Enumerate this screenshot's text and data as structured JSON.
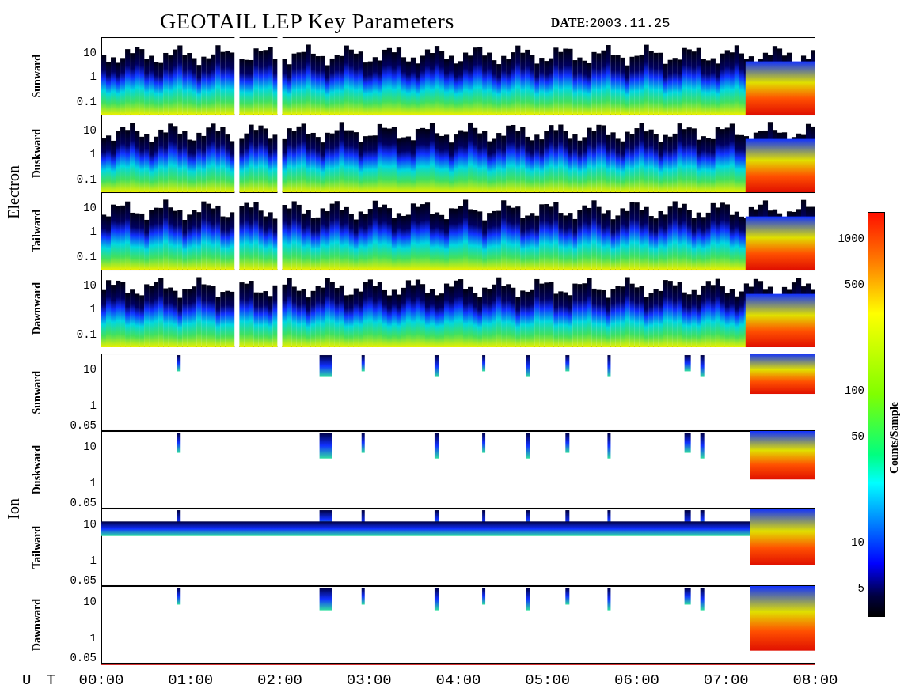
{
  "title": "GEOTAIL LEP Key Parameters",
  "date_label": "DATE:",
  "date": "2003.11.25",
  "groups": [
    {
      "name": "Electron",
      "kind": "electron",
      "panels": [
        {
          "name": "Sunward",
          "yticks": [
            "10",
            "1",
            "0.1"
          ]
        },
        {
          "name": "Duskward",
          "yticks": [
            "10",
            "1",
            "0.1"
          ]
        },
        {
          "name": "Tailward",
          "yticks": [
            "10",
            "1",
            "0.1"
          ]
        },
        {
          "name": "Dawnward",
          "yticks": [
            "10",
            "1",
            "0.1"
          ]
        }
      ]
    },
    {
      "name": "Ion",
      "kind": "ion",
      "panels": [
        {
          "name": "Sunward",
          "yticks": [
            "10",
            "1",
            "0.05"
          ]
        },
        {
          "name": "Duskward",
          "yticks": [
            "10",
            "1",
            "0.05"
          ]
        },
        {
          "name": "Tailward",
          "yticks": [
            "10",
            "1",
            "0.05"
          ]
        },
        {
          "name": "Dawnward",
          "yticks": [
            "10",
            "1",
            "0.05"
          ]
        }
      ]
    }
  ],
  "colorbar": {
    "label": "Counts/Sample",
    "ticks": [
      "1000",
      "500",
      "100",
      "50",
      "10",
      "5"
    ]
  },
  "x_axis": {
    "label": "U T",
    "ticks": [
      "00:00",
      "01:00",
      "02:00",
      "03:00",
      "04:00",
      "05:00",
      "06:00",
      "07:00",
      "08:00"
    ]
  }
}
